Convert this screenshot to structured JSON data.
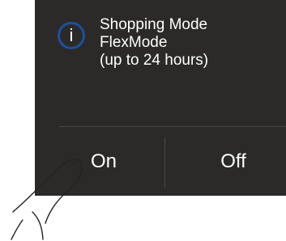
{
  "dialog": {
    "icon": "info-icon",
    "icon_glyph": "i",
    "message_lines": [
      "Shopping Mode",
      "FlexMode",
      "(up to 24 hours)"
    ],
    "on_label": "On",
    "off_label": "Off"
  },
  "illustration": {
    "icon": "finger-pointer-icon"
  },
  "colors": {
    "panel": "#2b2a28",
    "icon_ring": "#1e4fa3",
    "text": "#ffffff",
    "divider": "#4a4946"
  }
}
